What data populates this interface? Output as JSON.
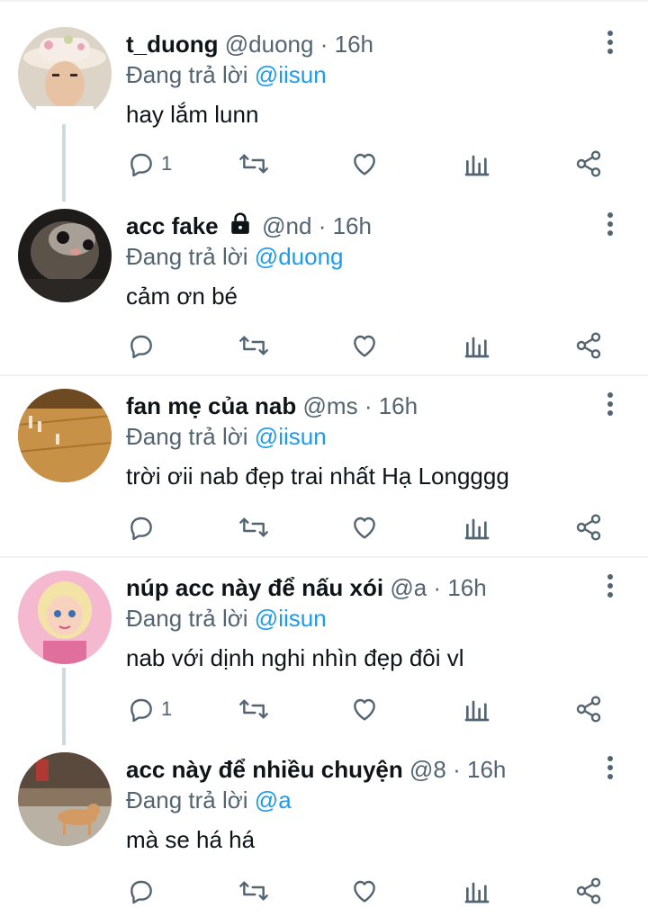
{
  "reply_prefix": "Đang trả lời",
  "tweets": [
    {
      "name": "t_duong",
      "handle": "@duong",
      "sep": "·",
      "time": "16h",
      "reply_to": "@iisun",
      "text": "hay lắm lunn",
      "reply_count": "1",
      "locked": false
    },
    {
      "name": "acc fake",
      "handle": "@nd",
      "sep": "·",
      "time": "16h",
      "reply_to": "@duong",
      "text": "cảm ơn bé",
      "reply_count": "",
      "locked": true
    },
    {
      "name": "fan mẹ của nab",
      "handle": "@ms",
      "sep": "·",
      "time": "16h",
      "reply_to": "@iisun",
      "text": "trời ơii nab đẹp trai nhất Hạ Longggg",
      "reply_count": "",
      "locked": false
    },
    {
      "name": "núp acc này để nấu xói",
      "handle": "@a",
      "sep": "·",
      "time": "16h",
      "reply_to": "@iisun",
      "text": "nab với dịnh nghi nhìn đẹp đôi vl",
      "reply_count": "1",
      "locked": false
    },
    {
      "name": "acc này để nhiều chuyện",
      "handle": "@8",
      "sep": "·",
      "time": "16h",
      "reply_to": "@a",
      "text": "mà se há há",
      "reply_count": "",
      "locked": false
    }
  ],
  "colors": {
    "accent": "#1d9bf0",
    "secondary_text": "#536471",
    "primary_text": "#0f1419",
    "divider": "#eff3f4"
  },
  "icons": [
    "reply-icon",
    "retweet-icon",
    "like-icon",
    "analytics-icon",
    "share-icon",
    "more-options-icon",
    "lock-icon"
  ]
}
